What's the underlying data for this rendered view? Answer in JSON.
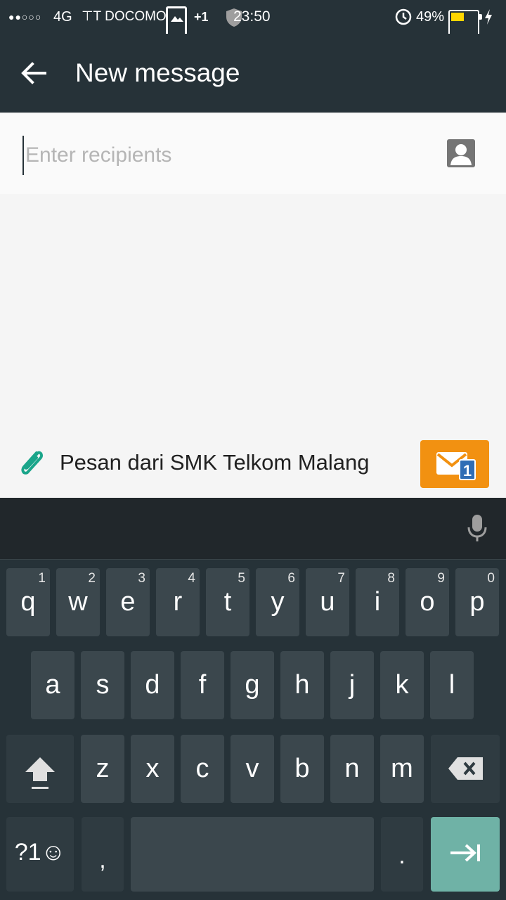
{
  "status_bar": {
    "signal_dots": "●●○○○",
    "network": "4G",
    "carrier": "⊤T DOCOMO",
    "notification_count": "+1",
    "time": "23:50",
    "battery_percent": "49%",
    "battery_level": 0.49
  },
  "toolbar": {
    "title": "New message"
  },
  "recipients": {
    "placeholder": "Enter recipients",
    "value": ""
  },
  "compose": {
    "message": "Pesan dari SMK Telkom Malang",
    "sim_number": "1"
  },
  "keyboard": {
    "row1": [
      {
        "letter": "q",
        "hint": "1"
      },
      {
        "letter": "w",
        "hint": "2"
      },
      {
        "letter": "e",
        "hint": "3"
      },
      {
        "letter": "r",
        "hint": "4"
      },
      {
        "letter": "t",
        "hint": "5"
      },
      {
        "letter": "y",
        "hint": "6"
      },
      {
        "letter": "u",
        "hint": "7"
      },
      {
        "letter": "i",
        "hint": "8"
      },
      {
        "letter": "o",
        "hint": "9"
      },
      {
        "letter": "p",
        "hint": "0"
      }
    ],
    "row2": [
      "a",
      "s",
      "d",
      "f",
      "g",
      "h",
      "j",
      "k",
      "l"
    ],
    "row3": [
      "z",
      "x",
      "c",
      "v",
      "b",
      "n",
      "m"
    ],
    "symbols_label": "?1☺",
    "comma": ",",
    "period": "."
  },
  "colors": {
    "app_bar": "#263238",
    "send_button": "#f29111",
    "clip": "#1aa58a",
    "enter_key": "#6fb2a6"
  }
}
